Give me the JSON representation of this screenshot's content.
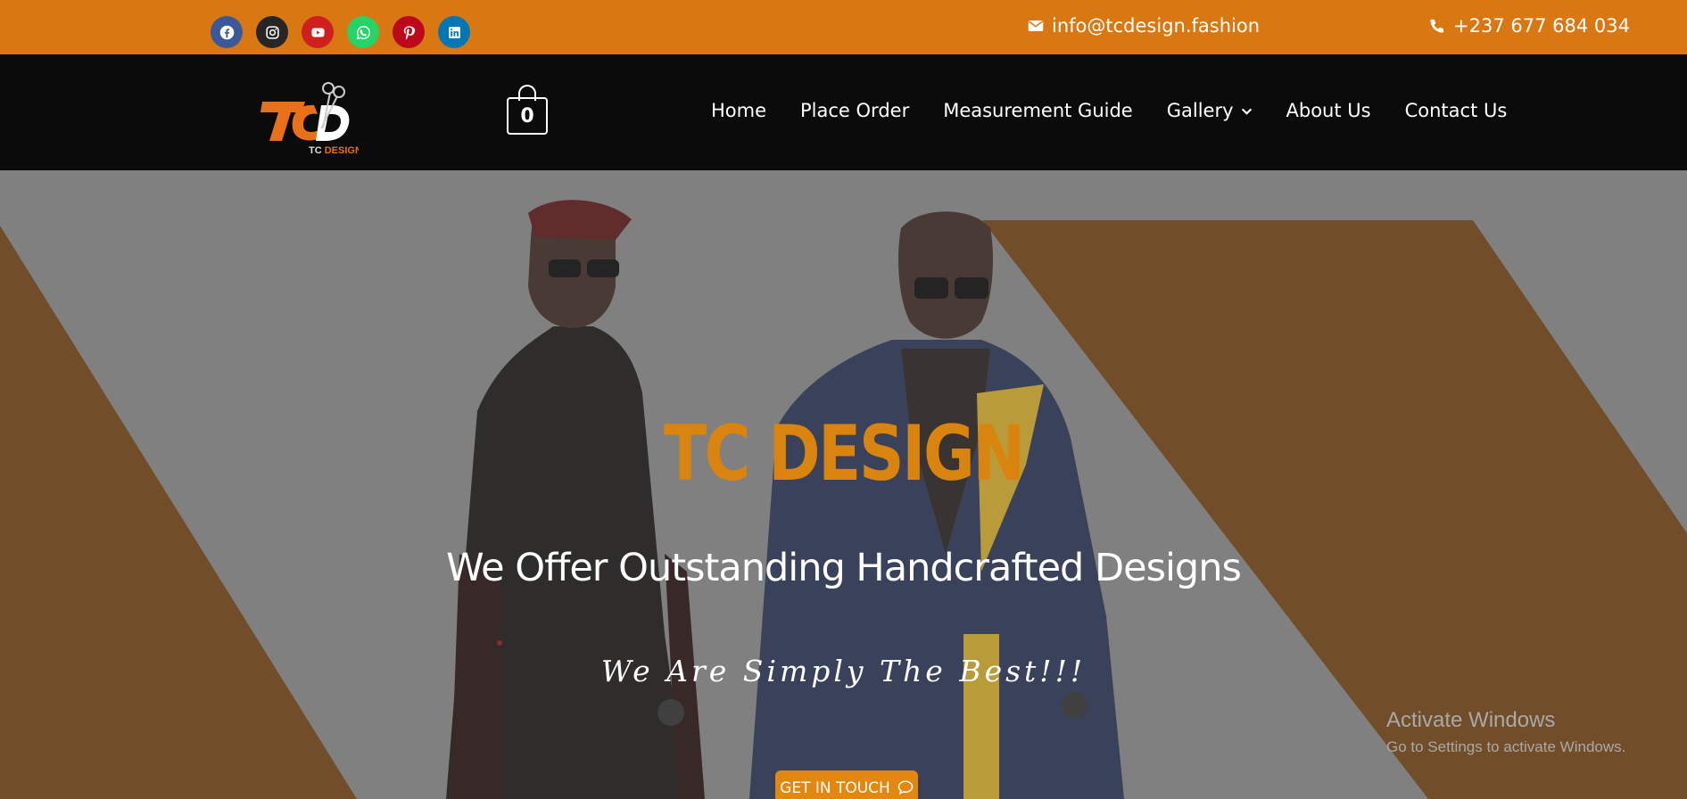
{
  "topbar": {
    "socials": [
      {
        "icon": "facebook-icon",
        "color": "#3b5998"
      },
      {
        "icon": "instagram-icon",
        "color": "#262626"
      },
      {
        "icon": "youtube-icon",
        "color": "#cd201f"
      },
      {
        "icon": "whatsapp-icon",
        "color": "#25d366"
      },
      {
        "icon": "pinterest-icon",
        "color": "#bd081c"
      },
      {
        "icon": "linkedin-icon",
        "color": "#0077b5"
      }
    ],
    "email": "info@tcdesign.fashion",
    "phone": "+237 677 684 034",
    "background": "#d97712"
  },
  "navbar": {
    "logo_text": "TC DESIGN",
    "cart_count": "0",
    "menu": [
      {
        "label": "Home"
      },
      {
        "label": "Place Order"
      },
      {
        "label": "Measurement Guide"
      },
      {
        "label": "Gallery"
      },
      {
        "label": "About Us"
      },
      {
        "label": "Contact Us"
      }
    ],
    "background": "#0b0b0b"
  },
  "hero": {
    "title": "TC DESIGN",
    "subtitle": "We Offer Outstanding Handcrafted Designs",
    "tagline": "We Are Simply The Best!!!",
    "cta_label": "GET IN TOUCH",
    "accent": "#d9840e",
    "band_color": "#6e4416"
  },
  "watermark": {
    "title": "Activate Windows",
    "subtitle": "Go to Settings to activate Windows."
  }
}
